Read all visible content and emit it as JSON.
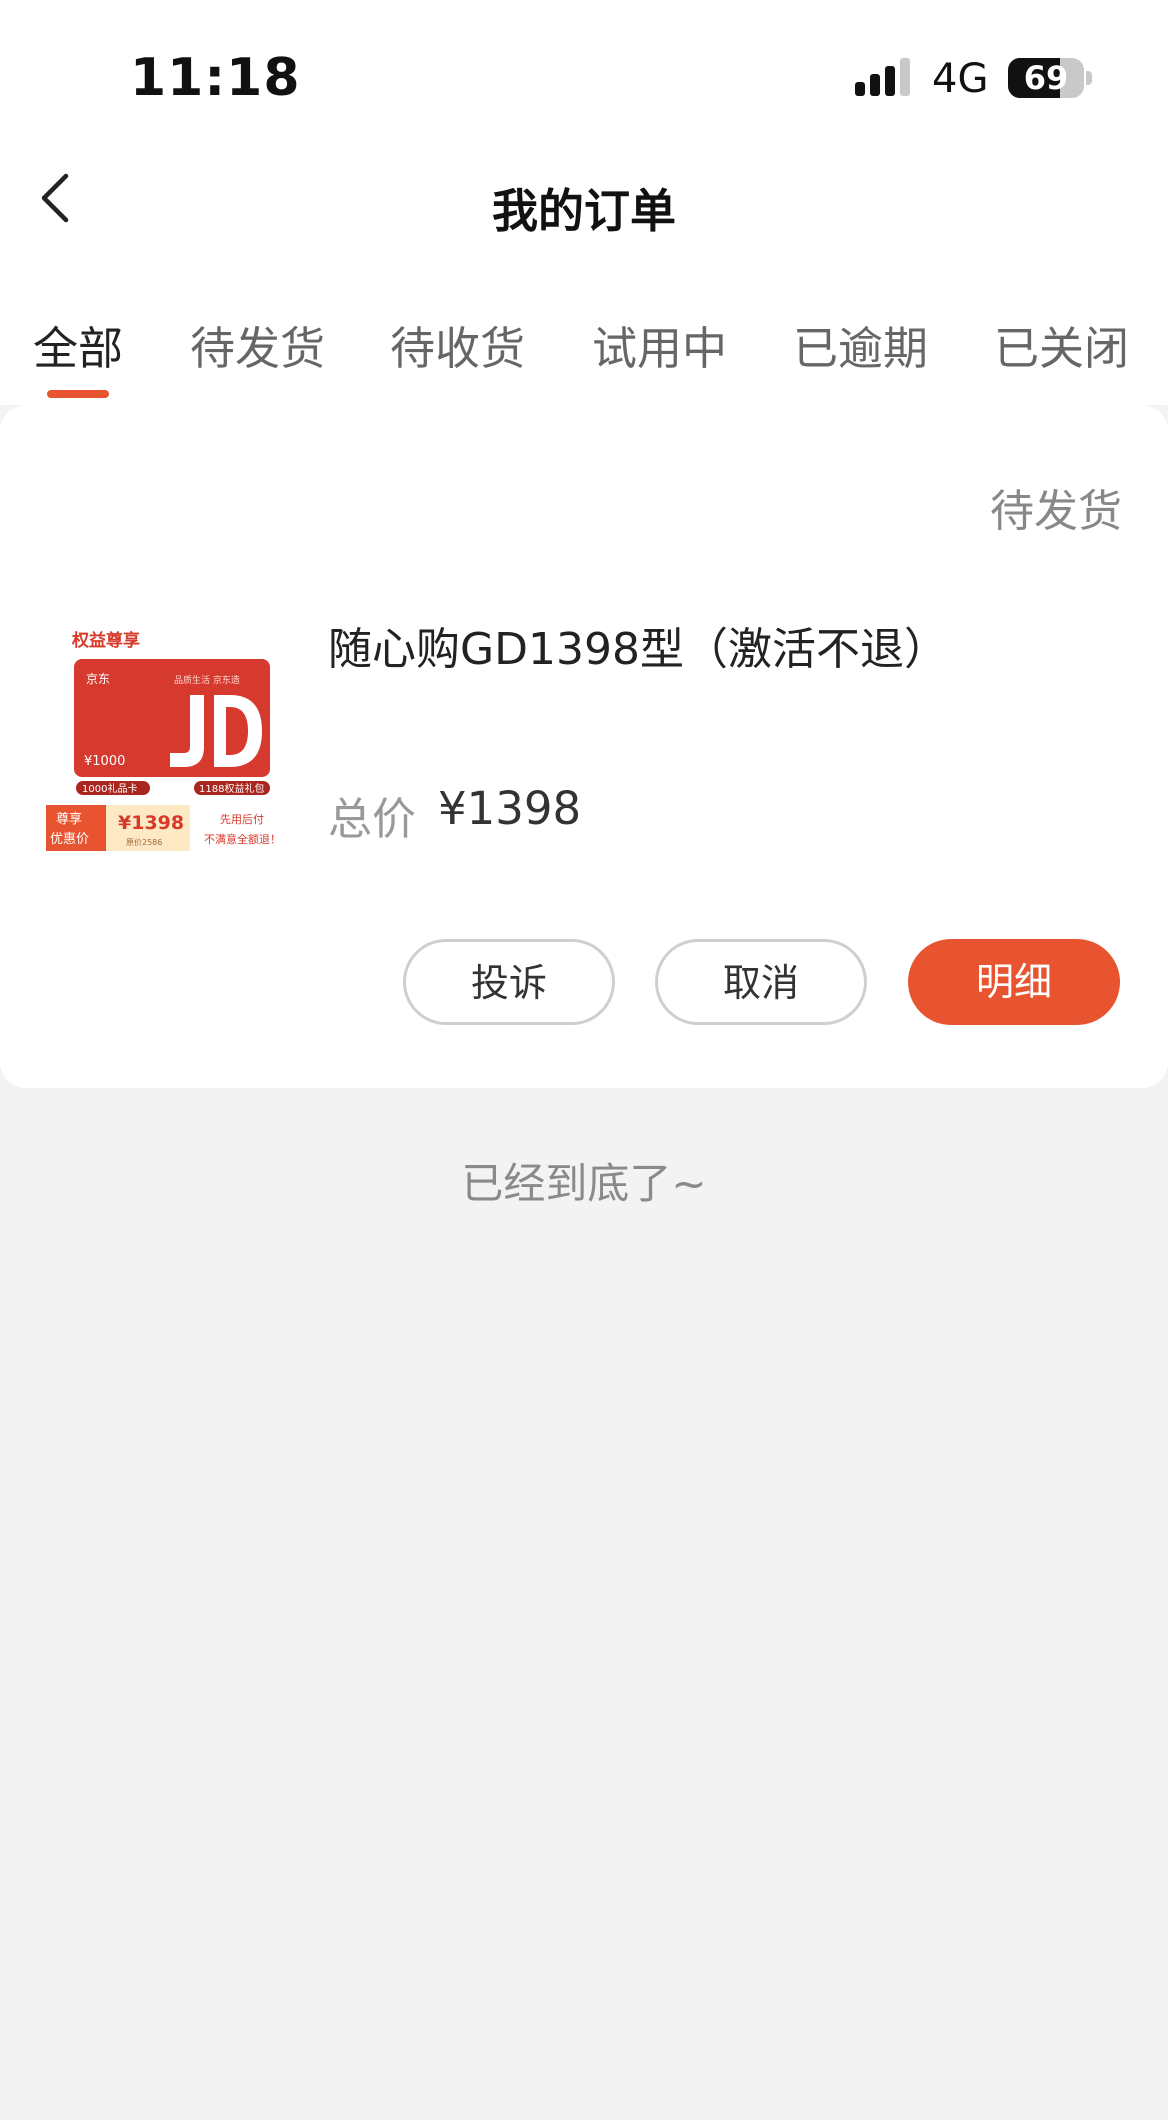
{
  "status_bar": {
    "time": "11:18",
    "network": "4G",
    "battery": "69",
    "battery_level": 0.69
  },
  "nav": {
    "title": "我的订单"
  },
  "tabs": [
    {
      "label": "全部",
      "active": true
    },
    {
      "label": "待发货",
      "active": false
    },
    {
      "label": "待收货",
      "active": false
    },
    {
      "label": "试用中",
      "active": false
    },
    {
      "label": "已逾期",
      "active": false
    },
    {
      "label": "已关闭",
      "active": false
    }
  ],
  "order": {
    "status": "待发货",
    "product_name": "随心购GD1398型（激活不退）",
    "price_label": "总价",
    "price_value": "¥1398",
    "thumbnail": {
      "corner_label": "权益尊享",
      "brand": "京东",
      "card_slogan": "品质生活 京东造",
      "card_value": "¥1000",
      "tag_left": "1000礼品卡",
      "tag_right": "1188权益礼包",
      "promo_label_line1": "尊享",
      "promo_label_line2": "优惠价",
      "promo_price": "¥1398",
      "promo_subprice": "原价2586",
      "promo_note_line1": "先用后付",
      "promo_note_line2": "不满意全额退！"
    },
    "buttons": {
      "complain": "投诉",
      "cancel": "取消",
      "detail": "明细"
    }
  },
  "footer": {
    "end_text": "已经到底了~"
  },
  "colors": {
    "accent": "#e85430",
    "background": "#f3f3f3"
  }
}
